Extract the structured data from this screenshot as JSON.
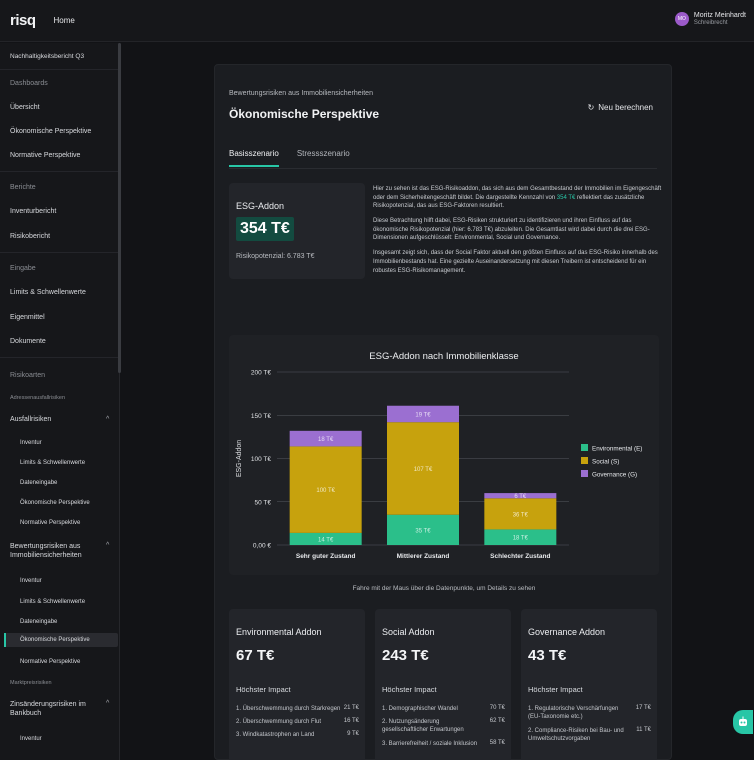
{
  "app": {
    "logo": "risq",
    "home": "Home"
  },
  "user": {
    "initials": "MO",
    "name": "Moritz Meinhardt",
    "role": "Schreibrecht"
  },
  "sidebar": {
    "report": "Nachhaltigkeitsbericht Q3",
    "dashboards": "Dashboards",
    "uebersicht": "Übersicht",
    "oekonomisch": "Ökonomische Perspektive",
    "normativ": "Normative Perspektive",
    "berichte": "Berichte",
    "inventurbericht": "Inventurbericht",
    "risikobericht": "Risikobericht",
    "eingabe": "Eingabe",
    "limits": "Limits & Schwellenwerte",
    "eigenmittel": "Eigenmittel",
    "dokumente": "Dokumente",
    "risikoarten": "Risikoarten",
    "adressen": "Adressenausfallrisiken",
    "ausfallrisiken": "Ausfallrisiken",
    "inventur": "Inventur",
    "limits_sub": "Limits & Schwellenwerte",
    "dateneingabe": "Dateneingabe",
    "oek_sub": "Ökonomische Perspektive",
    "norm_sub": "Normative Perspektive",
    "bewertung": "Bewertungsrisiken aus Immobiliensicherheiten",
    "inventur2": "Inventur",
    "limits_sub2": "Limits & Schwellenwerte",
    "dateneingabe2": "Dateneingabe",
    "oek_sub2": "Ökonomische Perspektive",
    "norm_sub2": "Normative Perspektive",
    "marktpreis": "Marktpreisrisiken",
    "zins": "Zinsänderungsrisiken im Bankbuch",
    "inventur3": "Inventur"
  },
  "main": {
    "breadcrumb": "Bewertungsrisiken aus Immobiliensicherheiten",
    "title": "Ökonomische Perspektive",
    "recalc": "Neu berechnen",
    "tabs": [
      "Basisszenario",
      "Stressszenario"
    ],
    "esg_label": "ESG-Addon",
    "esg_value": "354 T€",
    "potential": "Risikopotenzial: 6.783 T€",
    "p1_a": "Hier zu sehen ist das ESG-Risikoaddon, das sich aus dem Gesamtbestand der Immobilien im Eigengeschäft oder dem Sicherheitengeschäft bildet. Die dargestellte Kennzahl von ",
    "p1_hl": "354 T€",
    "p1_b": " reflektiert das zusätzliche Risikopotenzial, das aus ESG-Faktoren resultiert.",
    "p2": "Diese Betrachtung hilft dabei, ESG-Risiken strukturiert zu identifizieren und ihren Einfluss auf das ökonomische Risikopotenzial (hier: 6.783 T€) abzuleiten. Die Gesamtlast wird dabei durch die drei ESG-Dimensionen aufgeschlüsselt: Environmental, Social und Governance.",
    "p3": "Insgesamt zeigt sich, dass der Social Faktor aktuell den größten Einfluss auf das ESG-Risiko innerhalb des Immobilienbestands hat. Eine gezielte Auseinandersetzung mit diesen Treibern ist entscheidend für ein robustes ESG-Risikomanagement.",
    "chart_hint": "Fahre mit der Maus über die Datenpunkte, um Details zu sehen"
  },
  "colors": {
    "accent": "#28c6a6",
    "environmental": "#2bbf8a",
    "social": "#c7a20d",
    "governance": "#9b6fd1"
  },
  "chart_data": {
    "type": "bar",
    "title": "ESG-Addon nach Immobilienklasse",
    "ylabel": "ESG-Addon",
    "ylim": [
      0,
      200
    ],
    "yticks": [
      "0,00 €",
      "50 T€",
      "100 T€",
      "150 T€",
      "200 T€"
    ],
    "categories": [
      "Sehr guter Zustand",
      "Mittlerer Zustand",
      "Schlechter Zustand"
    ],
    "series": [
      {
        "name": "Environmental (E)",
        "values": [
          14,
          35,
          18
        ],
        "labels": [
          "14 T€",
          "35 T€",
          "18 T€"
        ]
      },
      {
        "name": "Social (S)",
        "values": [
          100,
          107,
          36
        ],
        "labels": [
          "100 T€",
          "107 T€",
          "36 T€"
        ]
      },
      {
        "name": "Governance (G)",
        "values": [
          18,
          19,
          6
        ],
        "labels": [
          "18 T€",
          "19 T€",
          "6 T€"
        ]
      }
    ],
    "legend": "right",
    "grid": false
  },
  "addons": [
    {
      "title": "Environmental Addon",
      "value": "67 T€",
      "heading": "Höchster Impact",
      "items": [
        {
          "label": "1. Überschwemmung durch Starkregen",
          "value": "21 T€"
        },
        {
          "label": "2. Überschwemmung durch Flut",
          "value": "16 T€"
        },
        {
          "label": "3. Windkatastrophen an Land",
          "value": "9 T€"
        }
      ]
    },
    {
      "title": "Social Addon",
      "value": "243 T€",
      "heading": "Höchster Impact",
      "items": [
        {
          "label": "1. Demographischer Wandel",
          "value": "70 T€"
        },
        {
          "label": "2. Nutzungsänderung gesellschaftlicher Erwartungen",
          "value": "62 T€"
        },
        {
          "label": "3. Barrierefreiheit / soziale Inklusion",
          "value": "58 T€"
        }
      ]
    },
    {
      "title": "Governance Addon",
      "value": "43 T€",
      "heading": "Höchster Impact",
      "items": [
        {
          "label": "1. Regulatorische Verschärfungen (EU-Taxonomie etc.)",
          "value": "17 T€"
        },
        {
          "label": "2. Compliance-Risiken bei Bau- und Umweltschutzvorgaben",
          "value": "11 T€"
        }
      ]
    }
  ]
}
